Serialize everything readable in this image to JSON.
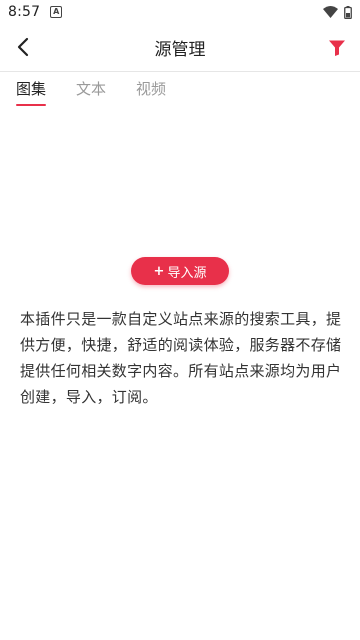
{
  "status_bar": {
    "time": "8:57",
    "notification_icon": "a-icon",
    "icons": [
      "wifi-icon",
      "battery-icon"
    ]
  },
  "header": {
    "back_icon": "chevron-left-icon",
    "title": "源管理",
    "filter_icon": "funnel-icon",
    "accent_color": "#e8304a"
  },
  "tabs": [
    {
      "label": "图集",
      "active": true
    },
    {
      "label": "文本",
      "active": false
    },
    {
      "label": "视频",
      "active": false
    }
  ],
  "import_button": {
    "plus": "+",
    "label": "导入源"
  },
  "description": "本插件只是一款自定义站点来源的搜索工具，提供方便，快捷，舒适的阅读体验，服务器不存储提供任何相关数字内容。所有站点来源均为用户创建，导入，订阅。"
}
